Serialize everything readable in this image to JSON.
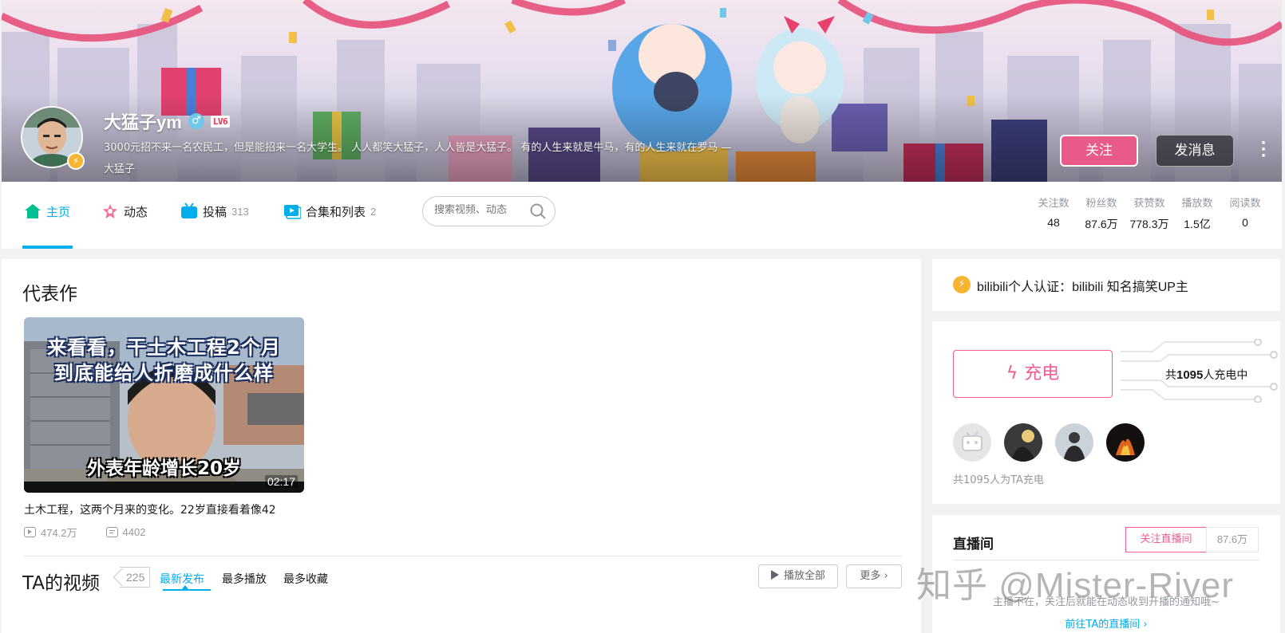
{
  "profile": {
    "username": "大猛子ym",
    "level": "LV6",
    "sign_line1": "3000元招不来一名农民工，但是能招来一名大学生。 人人都笑大猛子，人人皆是大猛子。 有的人生来就是牛马，有的人生来就在罗马 —",
    "sign_line2": "大猛子",
    "follow_label": "关注",
    "message_label": "发消息"
  },
  "nav": {
    "home": "主页",
    "dynamic": "动态",
    "uploads": "投稿",
    "uploads_count": "313",
    "collections": "合集和列表",
    "collections_count": "2",
    "search_placeholder": "搜索视频、动态"
  },
  "stats": [
    {
      "label": "关注数",
      "value": "48"
    },
    {
      "label": "粉丝数",
      "value": "87.6万"
    },
    {
      "label": "获赞数",
      "value": "778.3万"
    },
    {
      "label": "播放数",
      "value": "1.5亿"
    },
    {
      "label": "阅读数",
      "value": "0"
    }
  ],
  "masterpiece": {
    "section_title": "代表作",
    "thumb_line1": "来看看，干土木工程2个月",
    "thumb_line2": "到底能给人折磨成什么样",
    "thumb_line3": "外表年龄增长20岁",
    "duration": "02:17",
    "title": "土木工程，这两个月来的变化。22岁直接看着像42",
    "plays": "474.2万",
    "danmaku": "4402"
  },
  "videos": {
    "title": "TA的视频",
    "count": "225",
    "sort_latest": "最新发布",
    "sort_most_played": "最多播放",
    "sort_most_fav": "最多收藏",
    "play_all": "播放全部",
    "more": "更多"
  },
  "certification": {
    "text": "bilibili个人认证：bilibili 知名搞笑UP主"
  },
  "charge": {
    "button": "充电",
    "total_prefix": "共",
    "total_count": "1095",
    "total_suffix": "人充电中",
    "footer": "共1095人为TA充电"
  },
  "live": {
    "title": "直播间",
    "follow_live": "关注直播间",
    "fans": "87.6万",
    "notice": "主播不在，关注后就能在动态收到开播的通知哦~",
    "goto": "前往TA的直播间"
  },
  "watermark": "知乎 @Mister-River",
  "colors": {
    "accent": "#00aeec",
    "pink": "#f25d8e",
    "follow_button": "#e85a87",
    "badge_gold": "#f8b330"
  }
}
